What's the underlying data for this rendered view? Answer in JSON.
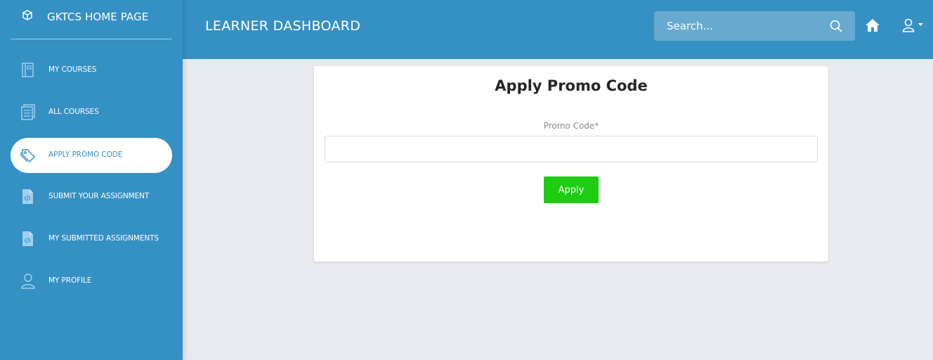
{
  "sidebar": {
    "brand_label": "GKTCS HOME PAGE",
    "items": [
      {
        "label": "MY COURSES",
        "icon": "book-icon"
      },
      {
        "label": "ALL COURSES",
        "icon": "list-document-icon"
      },
      {
        "label": "APPLY PROMO CODE",
        "icon": "tag-icon",
        "active": true
      },
      {
        "label": "SUBMIT YOUR ASSIGNMENT",
        "icon": "code-file-icon"
      },
      {
        "label": "MY SUBMITTED ASSIGNMENTS",
        "icon": "code-file-icon"
      },
      {
        "label": "MY PROFILE",
        "icon": "user-icon"
      }
    ]
  },
  "header": {
    "title": "LEARNER DASHBOARD",
    "search_placeholder": "Search..."
  },
  "card": {
    "title": "Apply Promo Code",
    "field_label": "Promo Code*",
    "promo_value": "",
    "apply_label": "Apply"
  },
  "colors": {
    "primary": "#3590c4",
    "apply_button": "#1dcc13",
    "background": "#e9eaef"
  }
}
